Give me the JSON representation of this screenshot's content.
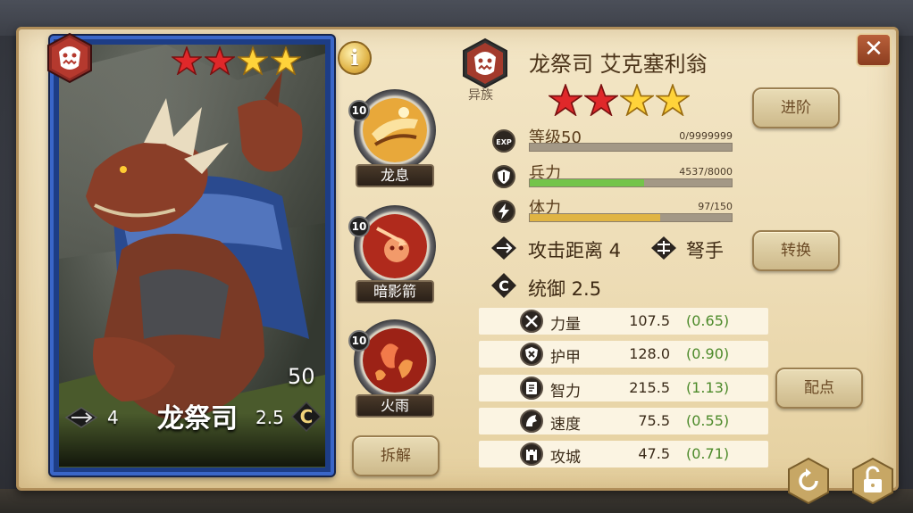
{
  "colors": {
    "panel": "#eddcb5",
    "card_frame": "#3a66c8",
    "accent_gold": "#e1b54a",
    "troop_bar": "#74c44a",
    "stamina_bar": "#e0b443",
    "growth_text": "#4c8a2a",
    "close_button": "#a04a28"
  },
  "card": {
    "name": "龙祭司",
    "power": "50",
    "attack_range": "4",
    "command": "2.5",
    "stars_filled_red": 2,
    "stars_total": 4,
    "race_icon": "monster-face-icon"
  },
  "info_button": {
    "label": "i"
  },
  "skills": [
    {
      "name": "龙息",
      "level": "10",
      "icon": "dragon-breath-icon"
    },
    {
      "name": "暗影箭",
      "level": "10",
      "icon": "shadow-arrow-icon"
    },
    {
      "name": "火雨",
      "level": "10",
      "icon": "fire-rain-icon"
    }
  ],
  "dismantle_button": "拆解",
  "hero": {
    "race": "异族",
    "title": "龙祭司 艾克塞利翁",
    "stars_red": 2,
    "stars_total": 4
  },
  "bars": {
    "level": {
      "label": "等级50",
      "value": "0/9999999",
      "fill": 0.0,
      "icon": "exp-icon",
      "icon_text": "EXP"
    },
    "troops": {
      "label": "兵力",
      "value": "4537/8000",
      "fill": 0.567,
      "icon": "shield-icon"
    },
    "stamina": {
      "label": "体力",
      "value": "97/150",
      "fill": 0.647,
      "icon": "lightning-icon"
    }
  },
  "traits": {
    "attack_range": "攻击距离 4",
    "class": "弩手",
    "command": "统御 2.5"
  },
  "attributes": [
    {
      "name": "力量",
      "value": "107.5",
      "growth": "(0.65)",
      "icon": "crossed-swords-icon"
    },
    {
      "name": "护甲",
      "value": "128.0",
      "growth": "(0.90)",
      "icon": "shield-cross-icon"
    },
    {
      "name": "智力",
      "value": "215.5",
      "growth": "(1.13)",
      "icon": "book-icon"
    },
    {
      "name": "速度",
      "value": "75.5",
      "growth": "(0.55)",
      "icon": "horse-icon"
    },
    {
      "name": "攻城",
      "value": "47.5",
      "growth": "(0.71)",
      "icon": "castle-icon"
    }
  ],
  "buttons": {
    "advance": "进阶",
    "convert": "转换",
    "allocate": "配点",
    "close": "✕"
  },
  "bottom_icons": [
    "refresh-icon",
    "unlock-icon"
  ]
}
